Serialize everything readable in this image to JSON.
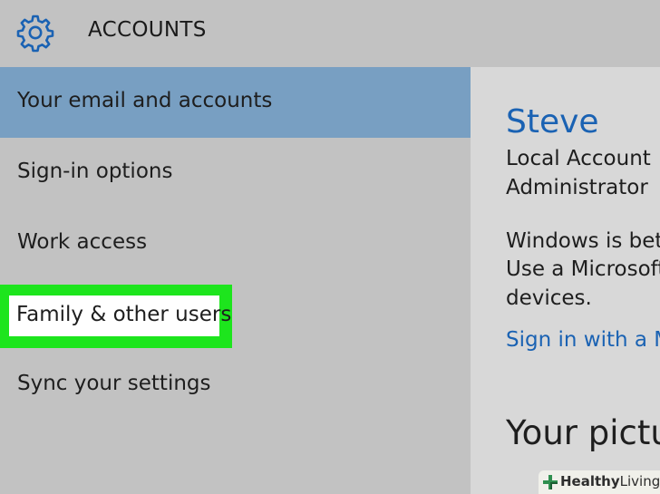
{
  "header": {
    "title": "ACCOUNTS",
    "icon": "gear-icon"
  },
  "colors": {
    "accent": "#1a62b3",
    "selected_bg": "#789fc2",
    "highlight_frame": "#1de51d",
    "sidebar_bg": "#c2c2c2",
    "content_bg": "#d8d8d8"
  },
  "sidebar": {
    "items": [
      {
        "label": "Your email and accounts",
        "state": "selected"
      },
      {
        "label": "Sign-in options",
        "state": "normal"
      },
      {
        "label": "Work access",
        "state": "normal"
      },
      {
        "label": "Family & other users",
        "state": "highlighted"
      },
      {
        "label": "Sync your settings",
        "state": "normal"
      }
    ]
  },
  "content": {
    "user_name": "Steve",
    "account_type": "Local Account",
    "account_role": "Administrator",
    "info_lines": [
      "Windows is bett",
      "Use a Microsoft",
      "devices."
    ],
    "signin_link": "Sign in with a M",
    "picture_heading": "Your pictu"
  },
  "watermark": {
    "part1": "Healthy",
    "part2": "Living"
  }
}
